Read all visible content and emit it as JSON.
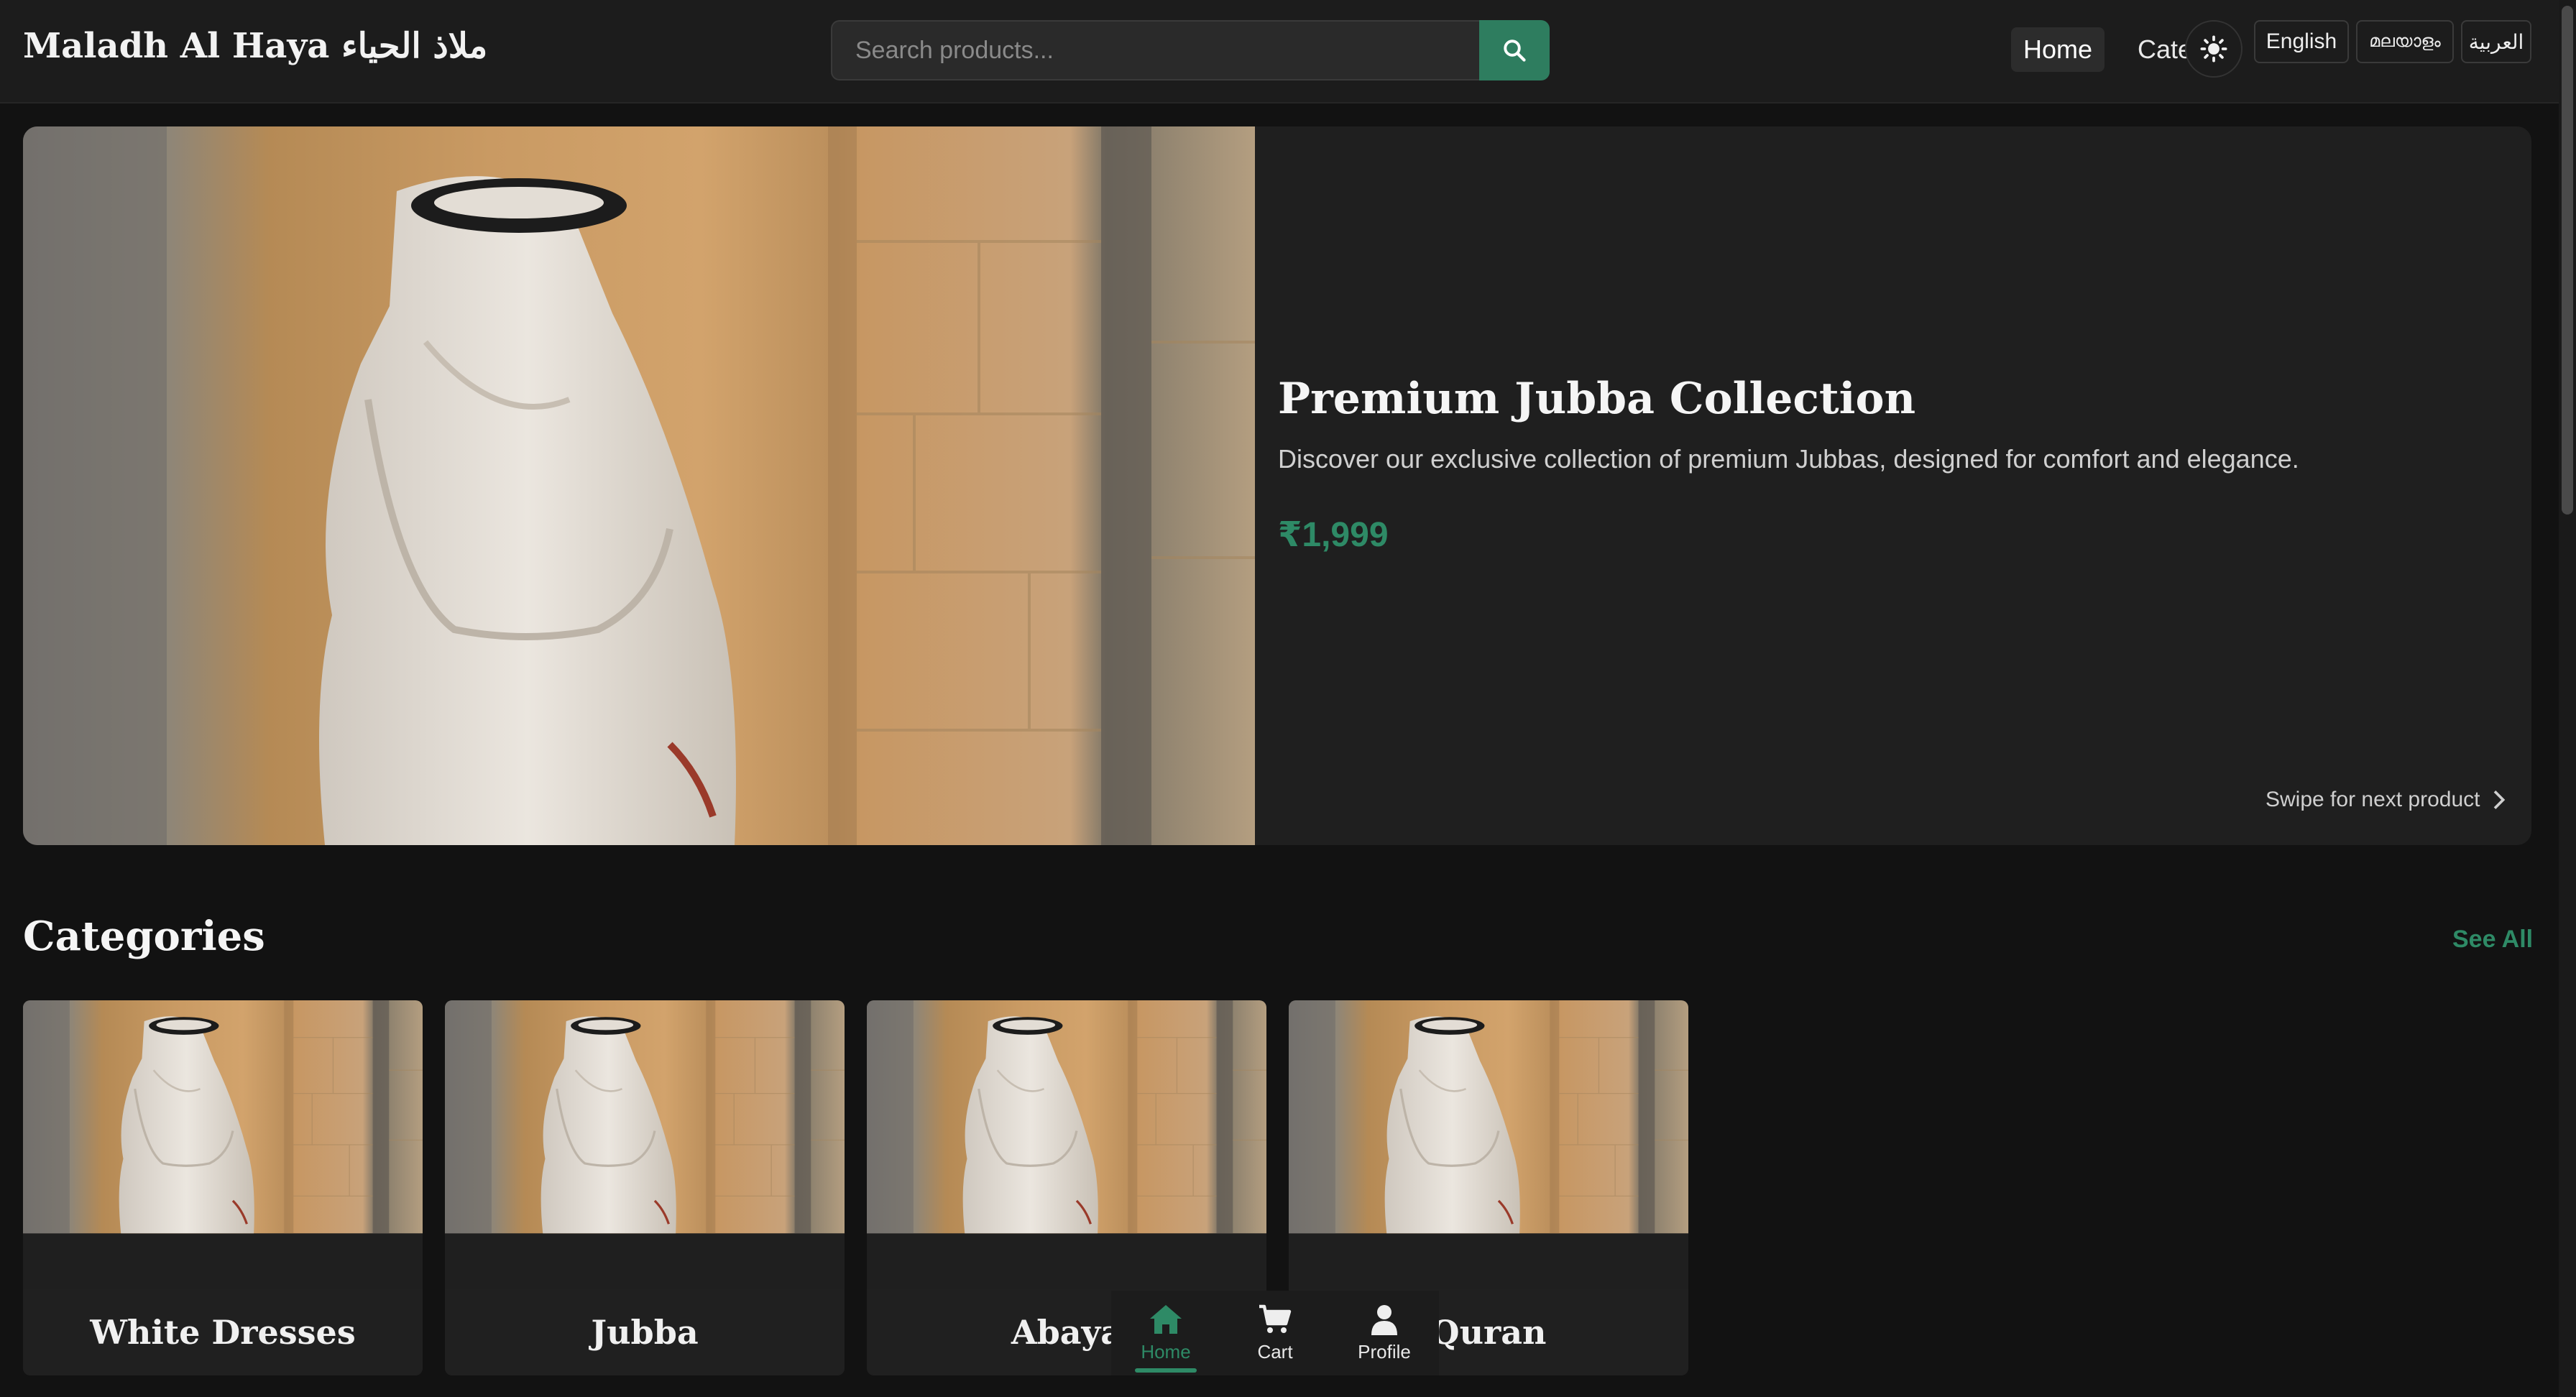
{
  "header": {
    "logo": "Maladh Al Haya ملاذ الحياء",
    "search_placeholder": "Search products...",
    "nav": {
      "home": "Home",
      "categories": "Categories"
    },
    "languages": [
      "English",
      "മലയാളം",
      "العربية"
    ]
  },
  "hero": {
    "title": "Premium Jubba Collection",
    "description": "Discover our exclusive collection of premium Jubbas, designed for comfort and elegance.",
    "price": "₹1,999",
    "swipe_hint": "Swipe for next product"
  },
  "categories": {
    "title": "Categories",
    "see_all": "See All",
    "items": [
      {
        "label": "White Dresses"
      },
      {
        "label": "Jubba"
      },
      {
        "label": "Abaya"
      },
      {
        "label": "Quran"
      }
    ]
  },
  "bottom_nav": {
    "items": [
      {
        "label": "Home",
        "icon": "home-icon",
        "active": true
      },
      {
        "label": "Cart",
        "icon": "cart-icon"
      },
      {
        "label": "Profile",
        "icon": "profile-icon"
      }
    ]
  },
  "colors": {
    "accent": "#2e8a66",
    "background": "#121212",
    "surface": "#1f1f1f"
  }
}
